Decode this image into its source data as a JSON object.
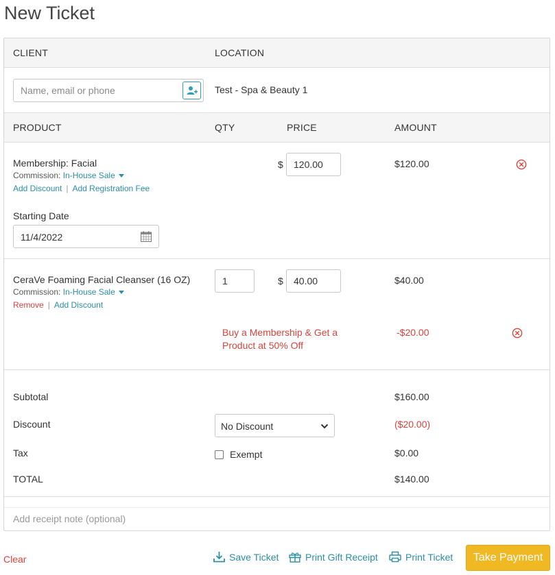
{
  "page": {
    "title": "New Ticket"
  },
  "headers": {
    "client": "CLIENT",
    "location": "LOCATION",
    "product": "PRODUCT",
    "qty": "QTY",
    "price": "PRICE",
    "amount": "AMOUNT"
  },
  "client": {
    "placeholder": "Name, email or phone",
    "value": ""
  },
  "location": {
    "value": "Test - Spa & Beauty 1"
  },
  "currency_symbol": "$",
  "items": [
    {
      "name": "Membership: Facial",
      "commission_label": "Commission:",
      "commission_value": "In-House Sale",
      "actions": [
        "Add Discount",
        "Add Registration Fee"
      ],
      "price": "120.00",
      "amount": "$120.00",
      "starting_date_label": "Starting Date",
      "starting_date": "11/4/2022"
    },
    {
      "name": "CeraVe Foaming Facial Cleanser (16 OZ)",
      "commission_label": "Commission:",
      "commission_value": "In-House Sale",
      "actions": [
        "Remove",
        "Add Discount"
      ],
      "qty": "1",
      "price": "40.00",
      "amount": "$40.00",
      "promo": {
        "text": "Buy a Membership & Get a Product at 50% Off",
        "amount": "-$20.00"
      }
    }
  ],
  "summary": {
    "subtotal_label": "Subtotal",
    "subtotal": "$160.00",
    "discount_label": "Discount",
    "discount_select": "No Discount",
    "discount": "($20.00)",
    "tax_label": "Tax",
    "exempt_label": "Exempt",
    "exempt_checked": false,
    "tax": "$0.00",
    "total_label": "TOTAL",
    "total": "$140.00"
  },
  "note": {
    "placeholder": "Add receipt note (optional)"
  },
  "footer": {
    "clear": "Clear",
    "save": "Save Ticket",
    "print_gift": "Print Gift Receipt",
    "print": "Print Ticket",
    "pay": "Take Payment"
  },
  "colors": {
    "link": "#2b8fa6",
    "danger": "#d9433b",
    "primary_button": "#f0b823",
    "header_band": "#f5f5f5"
  },
  "icons": {
    "add_client": "add-user-icon",
    "remove": "circle-x-icon",
    "calendar": "calendar-icon",
    "select": "chevron-down-icon",
    "save": "download-icon",
    "gift": "gift-icon",
    "print": "printer-icon"
  }
}
